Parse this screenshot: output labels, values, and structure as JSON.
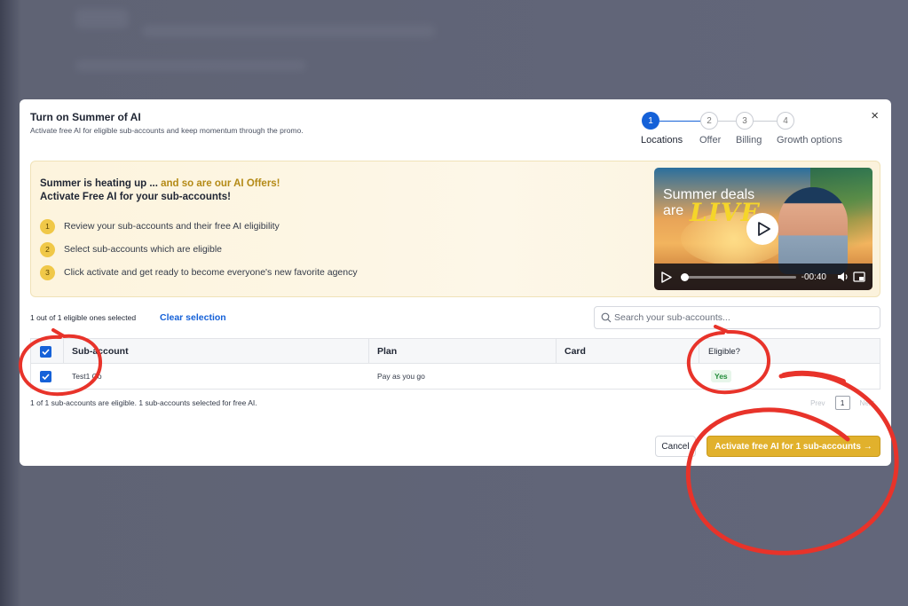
{
  "modal": {
    "title": "Turn on Summer of AI",
    "subtitle": "Activate free AI for eligible sub-accounts and keep momentum through the promo.",
    "close_label": "×"
  },
  "stepper": {
    "steps": [
      {
        "number": "1",
        "label": "Locations",
        "active": true
      },
      {
        "number": "2",
        "label": "Offer",
        "active": false
      },
      {
        "number": "3",
        "label": "Billing",
        "active": false
      },
      {
        "number": "4",
        "label": "Growth options",
        "active": false
      }
    ]
  },
  "promo": {
    "heading_prefix": "Summer is heating up ... ",
    "heading_highlight": "and so are our AI Offers!",
    "heading_line2": "Activate Free AI for your sub-accounts!",
    "steps": [
      {
        "number": "1",
        "text": "Review your sub-accounts and their free AI eligibility"
      },
      {
        "number": "2",
        "text": "Select sub-accounts which are eligible"
      },
      {
        "number": "3",
        "text": "Click activate and get ready to become everyone's new favorite agency"
      }
    ],
    "video": {
      "overlay_line1": "Summer deals",
      "overlay_line2": "are",
      "overlay_live": "LIVE",
      "time": "-00:40",
      "progress": 0.0
    }
  },
  "selection": {
    "info": "1 out of 1 eligible ones selected",
    "clear_label": "Clear selection"
  },
  "search": {
    "placeholder": "Search your sub-accounts..."
  },
  "table": {
    "headers": {
      "subaccount": "Sub-account",
      "plan": "Plan",
      "card": "Card",
      "eligible": "Eligible?"
    },
    "rows": [
      {
        "subaccount": "Test1 Co",
        "plan": "Pay as you go",
        "card": "",
        "eligible": "Yes",
        "checked": true
      }
    ]
  },
  "summary": "1 of 1 sub-accounts are eligible. 1 sub-accounts selected for free AI.",
  "pagination": {
    "prev_label": "Prev",
    "current_page": "1",
    "next_label": "Next"
  },
  "actions": {
    "cancel_label": "Cancel",
    "activate_label": "Activate free AI for 1 sub-accounts →"
  },
  "colors": {
    "primary": "#1561d8",
    "accent": "#e1b12c",
    "annotation": "#e8332a",
    "eligible": "#228b3a"
  },
  "icons": {
    "close": "close-icon",
    "search": "search-icon",
    "play": "play-icon",
    "volume": "volume-icon",
    "pip": "picture-in-picture-icon",
    "checkbox": "checkmark-icon"
  }
}
